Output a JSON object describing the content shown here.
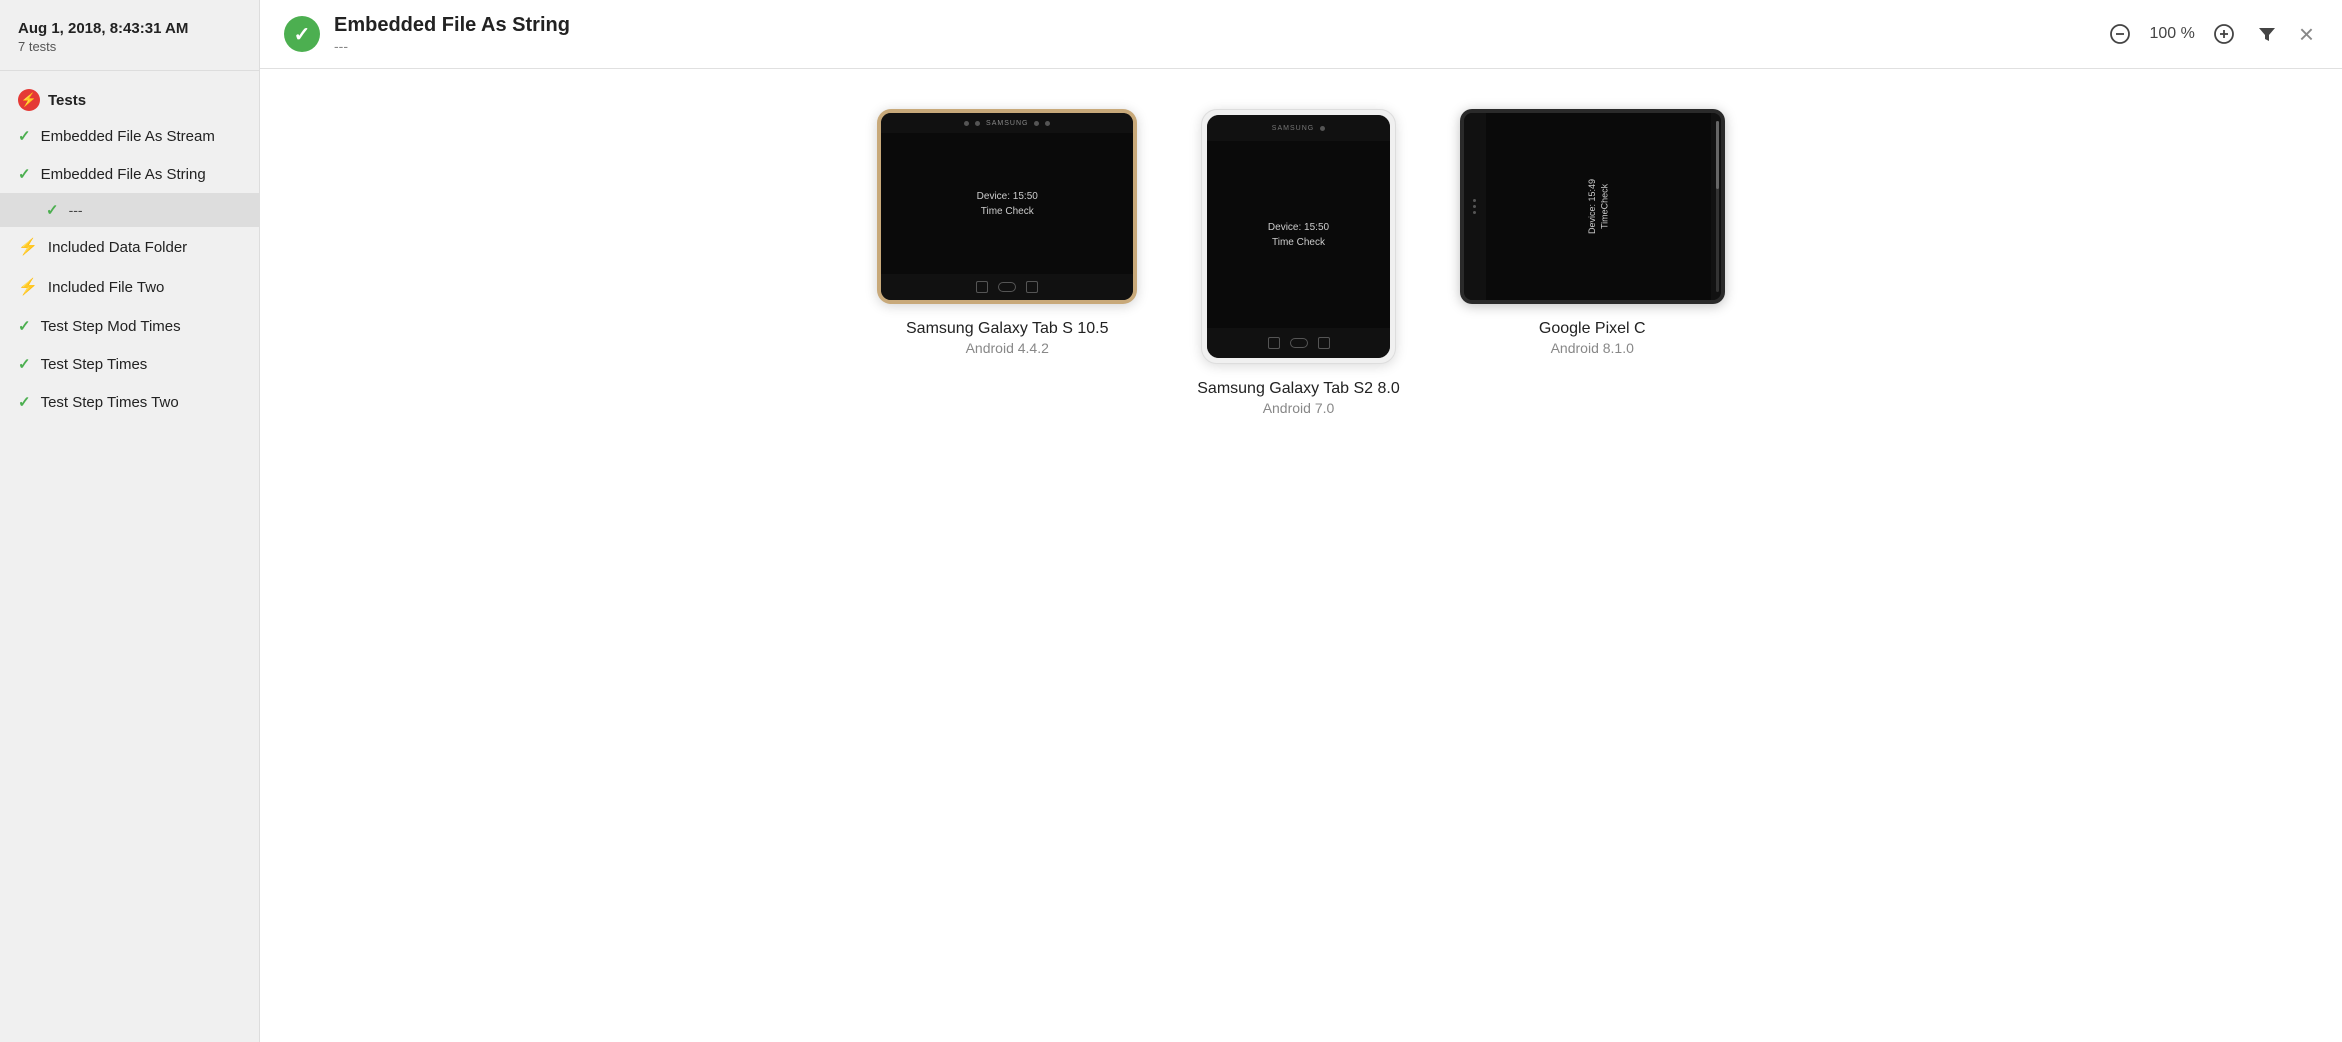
{
  "sidebar": {
    "date": "Aug 1, 2018, 8:43:31 AM",
    "test_count": "7 tests",
    "section_label": "Tests",
    "items": [
      {
        "id": "embedded-file-stream",
        "label": "Embedded File As Stream",
        "status": "pass"
      },
      {
        "id": "embedded-file-string",
        "label": "Embedded File As String",
        "status": "pass",
        "sub_items": [
          {
            "id": "triple-dash",
            "label": "---",
            "status": "pass"
          }
        ]
      },
      {
        "id": "included-data-folder",
        "label": "Included Data Folder",
        "status": "fail"
      },
      {
        "id": "included-file-two",
        "label": "Included File Two",
        "status": "fail"
      },
      {
        "id": "test-step-mod-times",
        "label": "Test Step Mod Times",
        "status": "pass"
      },
      {
        "id": "test-step-times",
        "label": "Test Step Times",
        "status": "pass"
      },
      {
        "id": "test-step-times-two",
        "label": "Test Step Times Two",
        "status": "pass"
      }
    ]
  },
  "topbar": {
    "title": "Embedded File As String",
    "subtitle": "---",
    "status": "pass",
    "zoom": "100 %"
  },
  "controls": {
    "zoom_out_label": "−",
    "zoom_in_label": "+",
    "filter_label": "▼",
    "close_label": "×"
  },
  "devices": [
    {
      "id": "samsung-tab-s-105",
      "name": "Samsung Galaxy Tab S 10.5",
      "os": "Android 4.4.2",
      "type": "tab-s-landscape",
      "screen_text_line1": "Device: 15:50",
      "screen_text_line2": "Time Check"
    },
    {
      "id": "samsung-tab-s2-80",
      "name": "Samsung Galaxy Tab S2 8.0",
      "os": "Android 7.0",
      "type": "tab-s2-portrait",
      "screen_text_line1": "Device: 15:50",
      "screen_text_line2": "Time Check"
    },
    {
      "id": "google-pixel-c",
      "name": "Google Pixel C",
      "os": "Android 8.1.0",
      "type": "pixel-c-landscape",
      "screen_text_line1": "Device: 15:49",
      "screen_text_line2": "TimeCheck"
    }
  ]
}
